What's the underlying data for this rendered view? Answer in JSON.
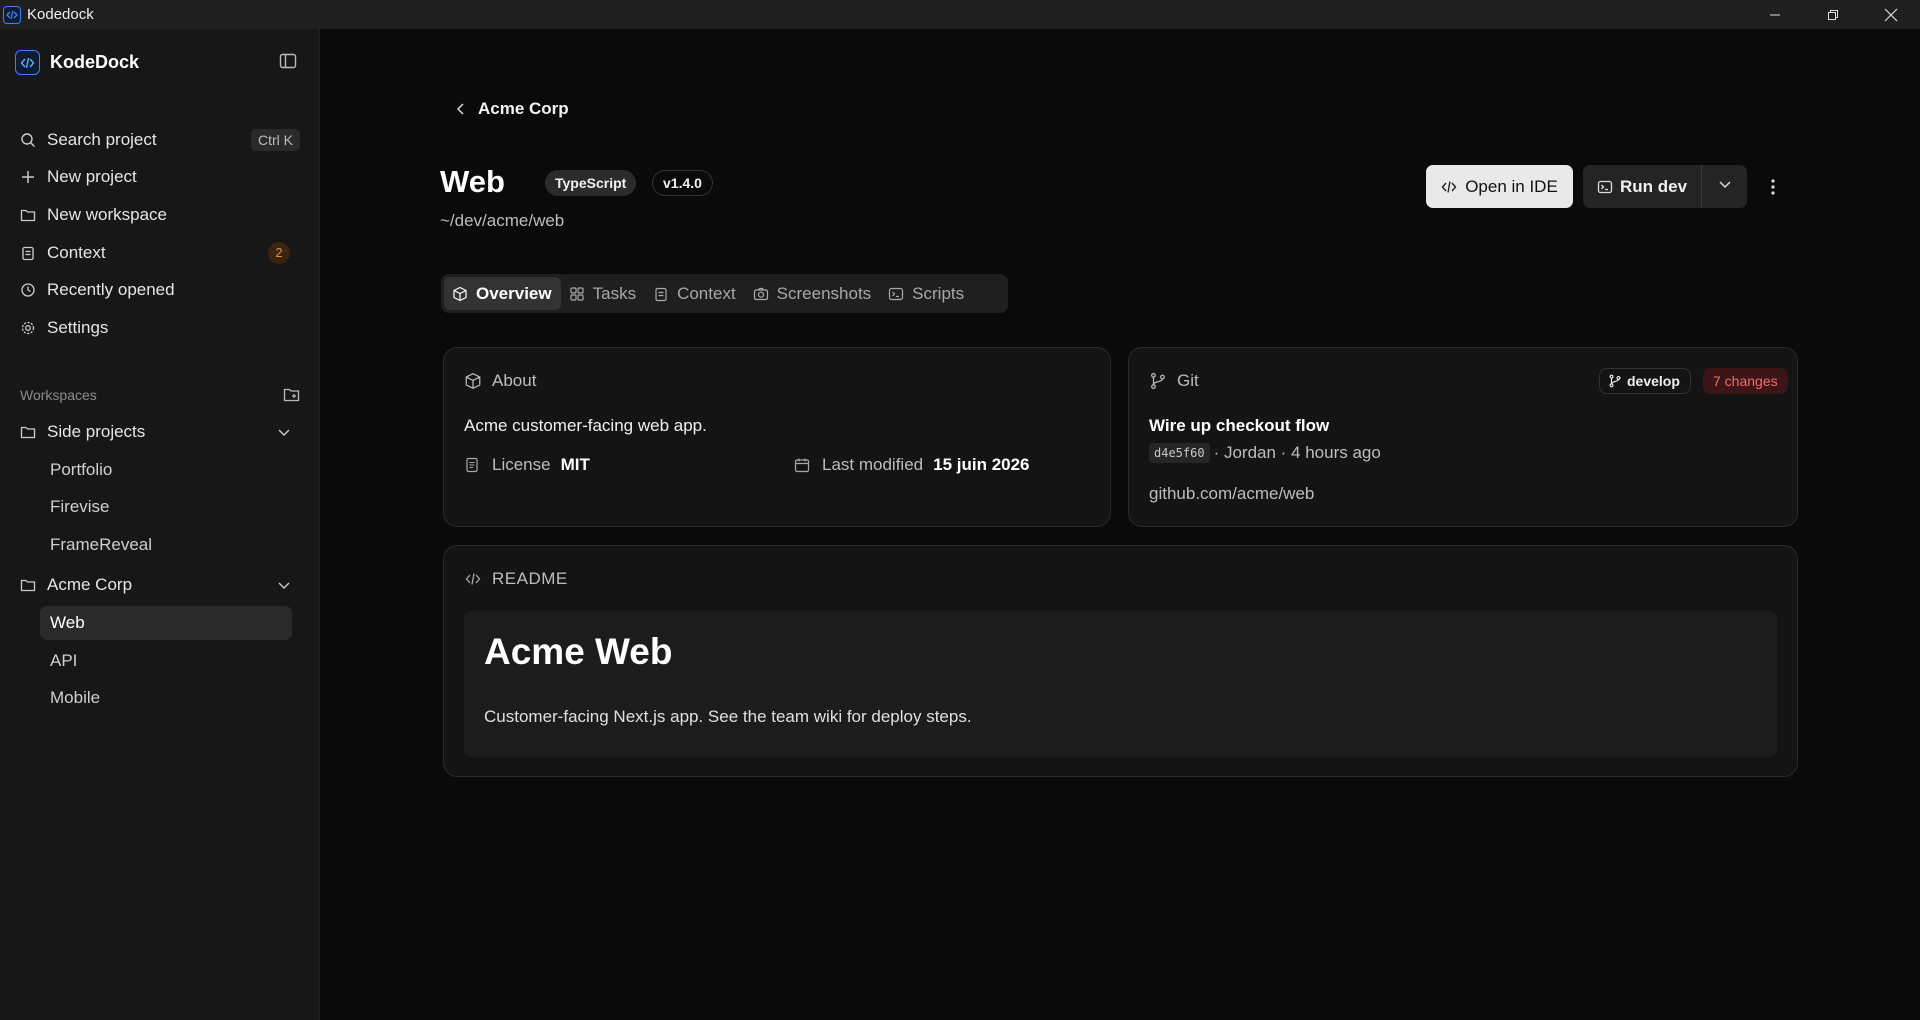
{
  "window": {
    "title": "Kodedock"
  },
  "sidebar": {
    "brand": "KodeDock",
    "nav": [
      {
        "label": "Search project",
        "icon": "search-icon",
        "shortcut": "Ctrl K"
      },
      {
        "label": "New project",
        "icon": "plus-icon"
      },
      {
        "label": "New workspace",
        "icon": "folder-plus-icon"
      },
      {
        "label": "Context",
        "icon": "clipboard-icon",
        "badge": "2"
      },
      {
        "label": "Recently opened",
        "icon": "clock-icon"
      },
      {
        "label": "Settings",
        "icon": "gear-icon"
      }
    ],
    "workspaces_label": "Workspaces",
    "workspaces": [
      {
        "name": "Side projects",
        "children": [
          "Portfolio",
          "Firevise",
          "FrameReveal"
        ]
      },
      {
        "name": "Acme Corp",
        "children": [
          "Web",
          "API",
          "Mobile"
        ],
        "active_child": "Web"
      }
    ]
  },
  "main": {
    "breadcrumb": "Acme Corp",
    "project": {
      "title": "Web",
      "language": "TypeScript",
      "version": "v1.4.0",
      "path": "~/dev/acme/web"
    },
    "actions": {
      "open_ide": "Open in IDE",
      "run_dev": "Run dev"
    },
    "tabs": [
      {
        "label": "Overview",
        "icon": "cube-icon",
        "active": true
      },
      {
        "label": "Tasks",
        "icon": "grid-icon"
      },
      {
        "label": "Context",
        "icon": "clipboard-icon"
      },
      {
        "label": "Screenshots",
        "icon": "camera-icon"
      },
      {
        "label": "Scripts",
        "icon": "terminal-icon"
      }
    ],
    "about": {
      "heading": "About",
      "description": "Acme customer-facing web app.",
      "license_label": "License",
      "license_value": "MIT",
      "modified_label": "Last modified",
      "modified_value": "15 juin 2026"
    },
    "git": {
      "heading": "Git",
      "branch": "develop",
      "changes": "7 changes",
      "commit_message": "Wire up checkout flow",
      "sha": "d4e5f60",
      "commit_meta": "· Jordan · 4 hours ago",
      "remote": "github.com/acme/web"
    },
    "readme": {
      "heading": "README",
      "title": "Acme Web",
      "body": "Customer-facing Next.js app. See the team wiki for deploy steps."
    }
  },
  "colors": {
    "accent_blue": "#3b82f6",
    "badge_orange": "#f08a36",
    "changes_red": "#f26d6d",
    "background": "#0a0a0a",
    "sidebar": "#171717"
  }
}
